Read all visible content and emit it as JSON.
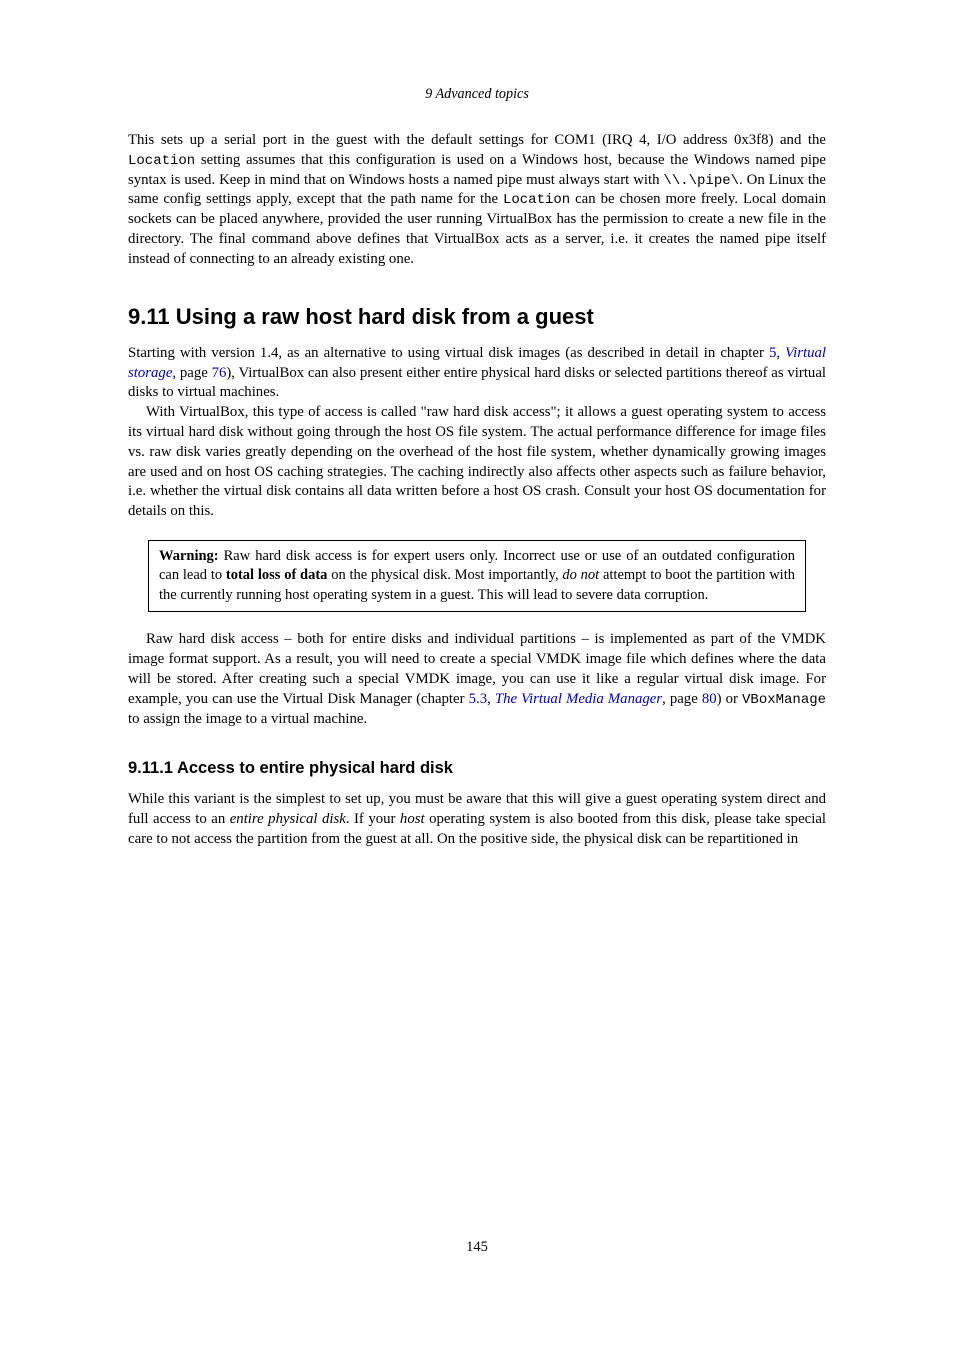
{
  "header": {
    "chapter": "9 Advanced topics"
  },
  "p1": {
    "t1": "This sets up a serial port in the guest with the default settings for COM1 (IRQ 4, I/O address 0x3f8) and the ",
    "c1": "Location",
    "t2": " setting assumes that this configuration is used on a Windows host, because the Windows named pipe syntax is used. Keep in mind that on Windows hosts a named pipe must always start with ",
    "c2": "\\\\.\\pipe\\",
    "t3": ". On Linux the same config settings apply, except that the path name for the ",
    "c3": "Location",
    "t4": " can be chosen more freely. Local domain sockets can be placed anywhere, provided the user running VirtualBox has the permission to create a new file in the directory. The final command above defines that VirtualBox acts as a server, i.e. it creates the named pipe itself instead of connecting to an already existing one."
  },
  "section": {
    "number": "9.11",
    "title": "Using a raw host hard disk from a guest"
  },
  "p2": {
    "t1": "Starting with version 1.4, as an alternative to using virtual disk images (as described in detail in chapter ",
    "l1": "5",
    "t2": ", ",
    "l2": "Virtual storage",
    "t3": ", page ",
    "l3": "76",
    "t4": "), VirtualBox can also present either entire physical hard disks or selected partitions thereof as virtual disks to virtual machines."
  },
  "p3": "With VirtualBox, this type of access is called \"raw hard disk access\"; it allows a guest operating system to access its virtual hard disk without going through the host OS file system. The actual performance difference for image files vs. raw disk varies greatly depending on the overhead of the host file system, whether dynamically growing images are used and on host OS caching strategies. The caching indirectly also affects other aspects such as failure behavior, i.e. whether the virtual disk contains all data written before a host OS crash. Consult your host OS documentation for details on this.",
  "warning": {
    "b1": "Warning:",
    "t1": " Raw hard disk access is for expert users only. Incorrect use or use of an outdated configuration can lead to ",
    "b2": "total loss of data",
    "t2": " on the physical disk. Most importantly, ",
    "i1": "do not",
    "t3": " attempt to boot the partition with the currently running host operating system in a guest. This will lead to severe data corruption."
  },
  "p4": {
    "t1": "Raw hard disk access – both for entire disks and individual partitions – is implemented as part of the VMDK image format support. As a result, you will need to create a special VMDK image file which defines where the data will be stored. After creating such a special VMDK image, you can use it like a regular virtual disk image. For example, you can use the Virtual Disk Manager (chapter ",
    "l1": "5.3",
    "t2": ", ",
    "l2": "The Virtual Media Manager",
    "t3": ", page ",
    "l3": "80",
    "t4": ") or ",
    "c1": "VBoxManage",
    "t5": " to assign the image to a virtual machine."
  },
  "subsection": {
    "number": "9.11.1",
    "title": "Access to entire physical hard disk"
  },
  "p5": {
    "t1": "While this variant is the simplest to set up, you must be aware that this will give a guest operating system direct and full access to an ",
    "i1": "entire physical disk",
    "t2": ". If your ",
    "i2": "host",
    "t3": " operating system is also booted from this disk, please take special care to not access the partition from the guest at all. On the positive side, the physical disk can be repartitioned in"
  },
  "pageNumber": "145"
}
